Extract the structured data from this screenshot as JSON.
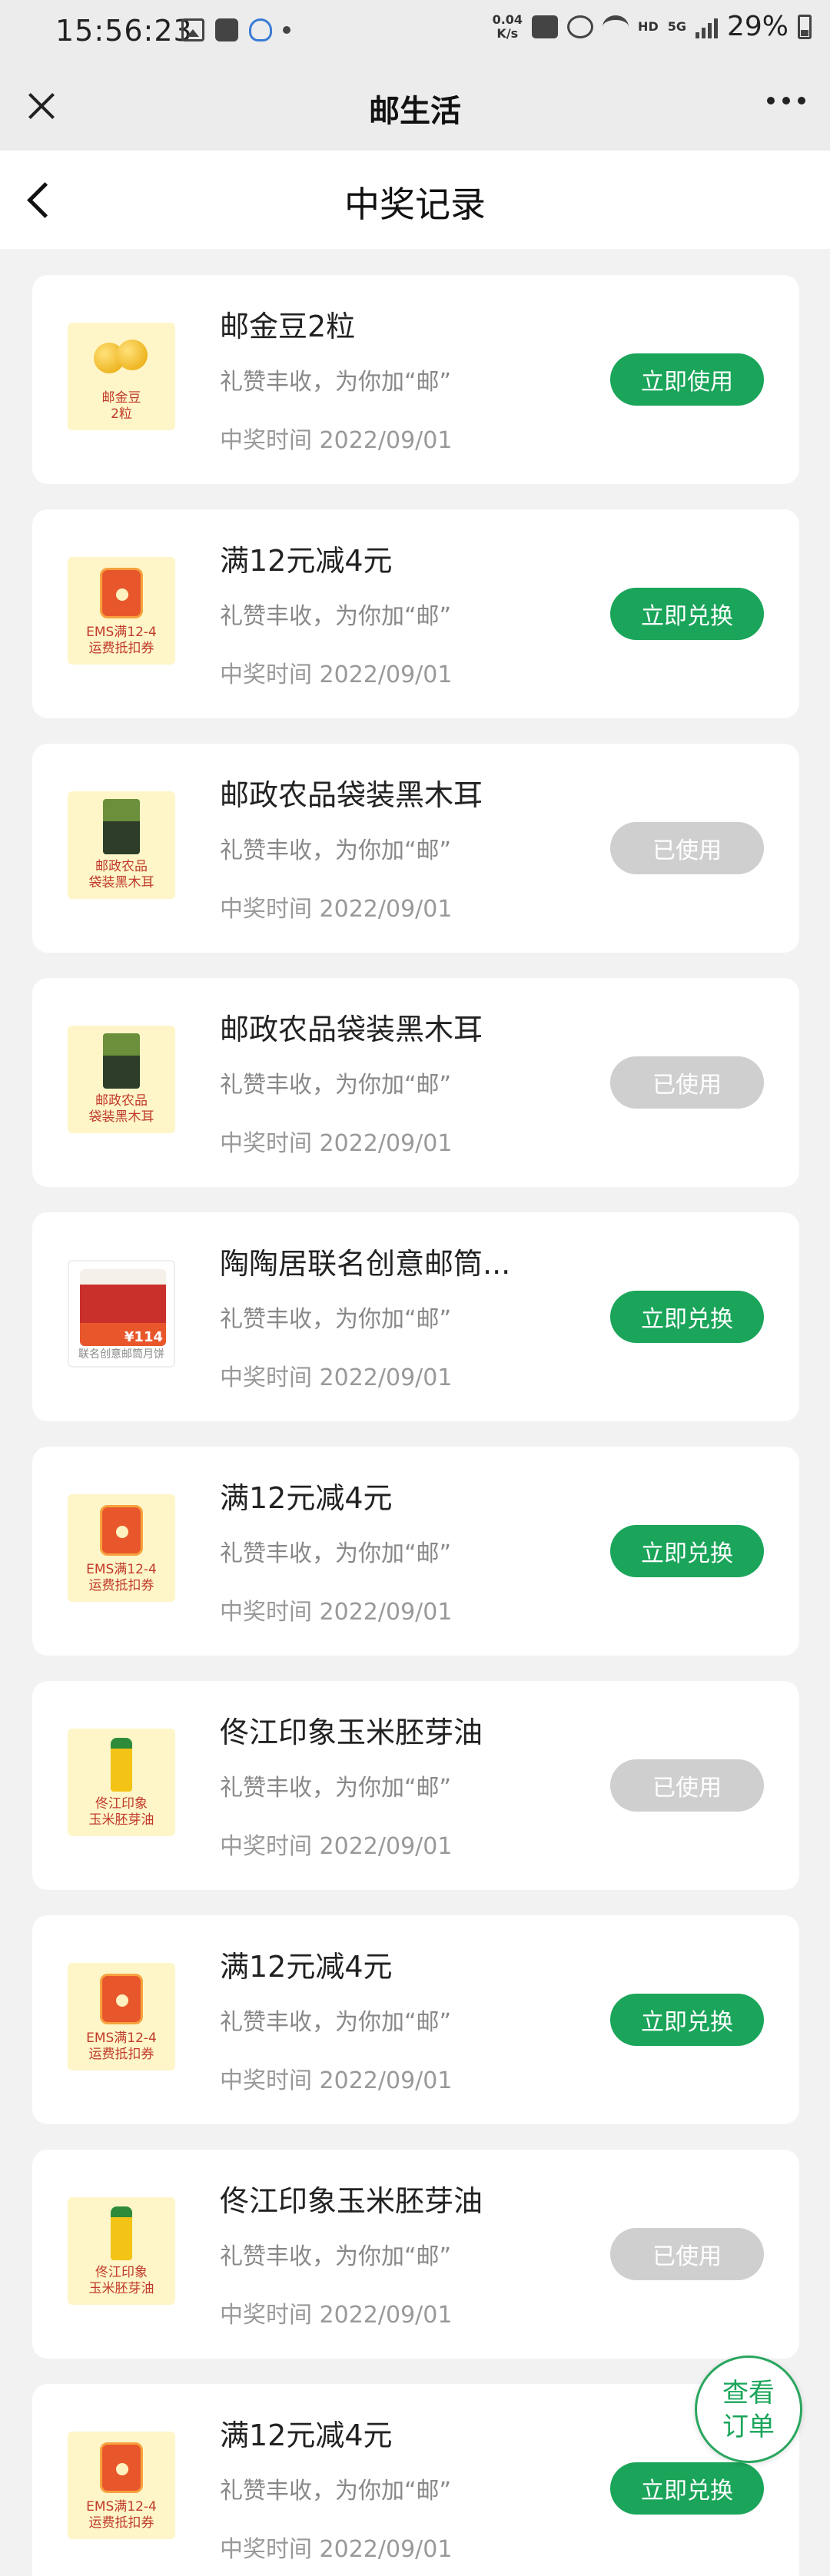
{
  "status_bar": {
    "time": "15:56:23",
    "net_speed_value": "0.04",
    "net_speed_unit": "K/s",
    "hd": "HD",
    "network": "5G",
    "battery": "29%"
  },
  "app_header": {
    "title": "邮生活"
  },
  "page": {
    "title": "中奖记录"
  },
  "records": [
    {
      "title": "邮金豆2粒",
      "subtitle": "礼赞丰收，为你加“邮”",
      "time": "中奖时间 2022/09/01",
      "button": "立即使用",
      "used": false,
      "thumb_type": "beans",
      "thumb_label": "邮金豆\n2粒"
    },
    {
      "title": "满12元减4元",
      "subtitle": "礼赞丰收，为你加“邮”",
      "time": "中奖时间 2022/09/01",
      "button": "立即兑换",
      "used": false,
      "thumb_type": "coupon",
      "thumb_label": "EMS满12-4\n运费抵扣券"
    },
    {
      "title": "邮政农品袋装黑木耳",
      "subtitle": "礼赞丰收，为你加“邮”",
      "time": "中奖时间 2022/09/01",
      "button": "已使用",
      "used": true,
      "thumb_type": "fungus",
      "thumb_label": "邮政农品\n袋装黑木耳"
    },
    {
      "title": "邮政农品袋装黑木耳",
      "subtitle": "礼赞丰收，为你加“邮”",
      "time": "中奖时间 2022/09/01",
      "button": "已使用",
      "used": true,
      "thumb_type": "fungus",
      "thumb_label": "邮政农品\n袋装黑木耳"
    },
    {
      "title": "陶陶居联名创意邮筒...",
      "subtitle": "礼赞丰收，为你加“邮”",
      "time": "中奖时间 2022/09/01",
      "button": "立即兑换",
      "used": false,
      "thumb_type": "mailbox",
      "thumb_label": "联名创意邮筒月饼",
      "thumb_price": "¥114"
    },
    {
      "title": "满12元减4元",
      "subtitle": "礼赞丰收，为你加“邮”",
      "time": "中奖时间 2022/09/01",
      "button": "立即兑换",
      "used": false,
      "thumb_type": "coupon",
      "thumb_label": "EMS满12-4\n运费抵扣券"
    },
    {
      "title": "佟江印象玉米胚芽油",
      "subtitle": "礼赞丰收，为你加“邮”",
      "time": "中奖时间 2022/09/01",
      "button": "已使用",
      "used": true,
      "thumb_type": "oil",
      "thumb_label": "佟江印象\n玉米胚芽油"
    },
    {
      "title": "满12元减4元",
      "subtitle": "礼赞丰收，为你加“邮”",
      "time": "中奖时间 2022/09/01",
      "button": "立即兑换",
      "used": false,
      "thumb_type": "coupon",
      "thumb_label": "EMS满12-4\n运费抵扣券"
    },
    {
      "title": "佟江印象玉米胚芽油",
      "subtitle": "礼赞丰收，为你加“邮”",
      "time": "中奖时间 2022/09/01",
      "button": "已使用",
      "used": true,
      "thumb_type": "oil",
      "thumb_label": "佟江印象\n玉米胚芽油"
    },
    {
      "title": "满12元减4元",
      "subtitle": "礼赞丰收，为你加“邮”",
      "time": "中奖时间 2022/09/01",
      "button": "立即兑换",
      "used": false,
      "thumb_type": "coupon",
      "thumb_label": "EMS满12-4\n运费抵扣券"
    }
  ],
  "fab": {
    "line1": "查看",
    "line2": "订单"
  },
  "colors": {
    "accent": "#1aa55a",
    "used_button": "#cfcfcf",
    "background": "#f2f2f2"
  }
}
